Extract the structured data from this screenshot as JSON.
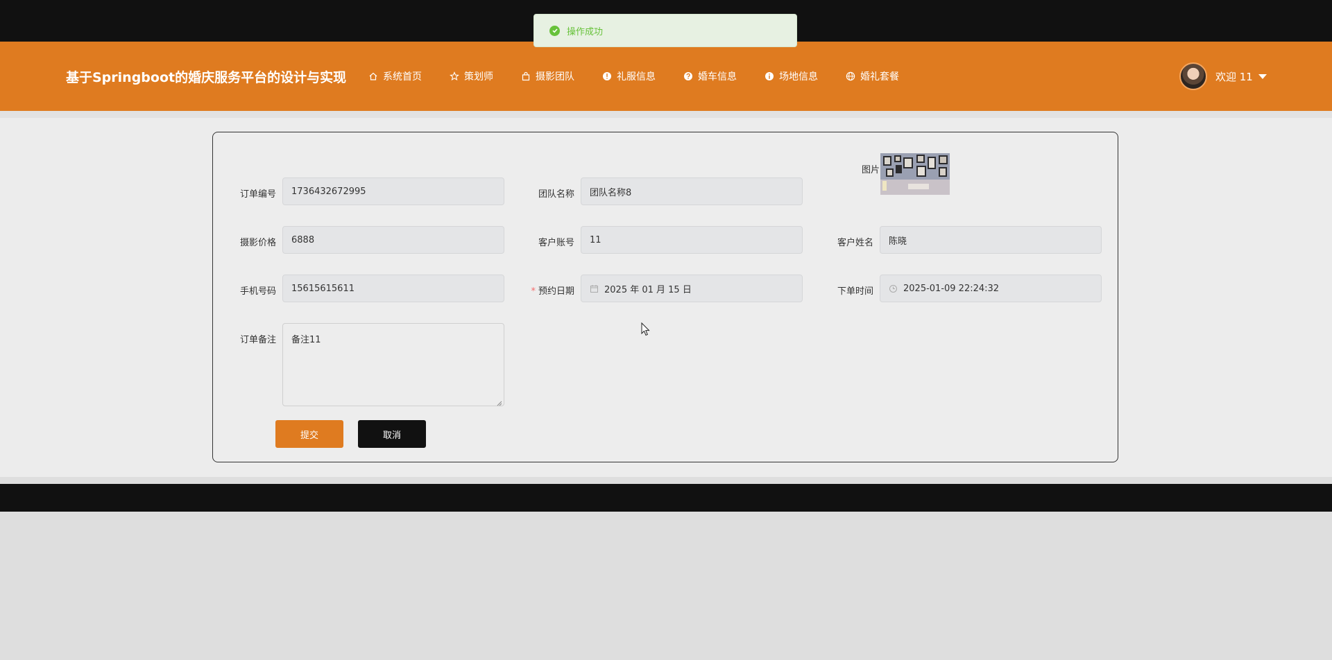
{
  "toast": {
    "message": "操作成功",
    "icon": "check-circle-icon",
    "color": "#67c23a"
  },
  "header": {
    "title": "基于Springboot的婚庆服务平台的设计与实现",
    "background": "#df7b20",
    "nav": [
      {
        "label": "系统首页",
        "icon": "home-icon"
      },
      {
        "label": "策划师",
        "icon": "star-icon"
      },
      {
        "label": "摄影团队",
        "icon": "bag-icon"
      },
      {
        "label": "礼服信息",
        "icon": "info-icon"
      },
      {
        "label": "婚车信息",
        "icon": "question-icon"
      },
      {
        "label": "场地信息",
        "icon": "info-icon"
      },
      {
        "label": "婚礼套餐",
        "icon": "globe-icon"
      }
    ],
    "user": {
      "greeting": "欢迎 11"
    }
  },
  "form": {
    "image_label": "图片",
    "fields": {
      "order_no": {
        "label": "订单编号",
        "value": "1736432672995"
      },
      "team_name": {
        "label": "团队名称",
        "value": "团队名称8"
      },
      "price": {
        "label": "摄影价格",
        "value": "6888"
      },
      "customer_account": {
        "label": "客户账号",
        "value": "11"
      },
      "customer_name": {
        "label": "客户姓名",
        "value": "陈晓"
      },
      "phone": {
        "label": "手机号码",
        "value": "15615615611"
      },
      "booking_date": {
        "label": "预约日期",
        "value": "2025 年 01 月 15 日",
        "required_mark": "*"
      },
      "order_time": {
        "label": "下单时间",
        "value": "2025-01-09 22:24:32"
      },
      "remark": {
        "label": "订单备注",
        "value": "备注11"
      }
    },
    "buttons": {
      "submit": "提交",
      "cancel": "取消"
    }
  }
}
